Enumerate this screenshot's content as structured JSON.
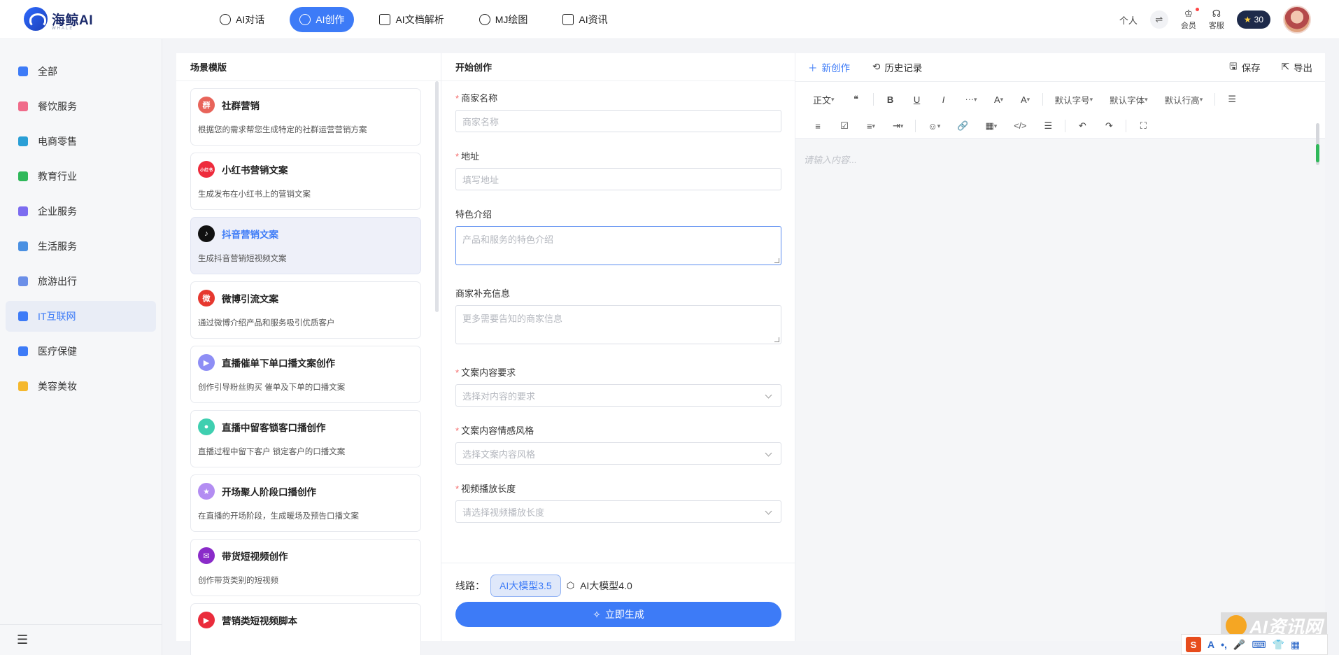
{
  "header": {
    "logo_text": "海鲸AI",
    "logo_sub": "WHALE",
    "nav": [
      {
        "label": "AI对话",
        "icon": "chat-icon",
        "active": false
      },
      {
        "label": "AI创作",
        "icon": "create-icon",
        "active": true
      },
      {
        "label": "AI文档解析",
        "icon": "pdf-icon",
        "active": false
      },
      {
        "label": "MJ绘图",
        "icon": "palette-icon",
        "active": false
      },
      {
        "label": "AI资讯",
        "icon": "news-icon",
        "active": false
      }
    ],
    "personal": "个人",
    "swap_icon": "⇌",
    "member": "会员",
    "service": "客服",
    "points": "30"
  },
  "sidebar": {
    "items": [
      {
        "label": "全部",
        "color": "#3d7bf7"
      },
      {
        "label": "餐饮服务",
        "color": "#f06b8a"
      },
      {
        "label": "电商零售",
        "color": "#2a9fd6"
      },
      {
        "label": "教育行业",
        "color": "#2fb85a"
      },
      {
        "label": "企业服务",
        "color": "#7c6cf0"
      },
      {
        "label": "生活服务",
        "color": "#4a90e2"
      },
      {
        "label": "旅游出行",
        "color": "#6b8fe8"
      },
      {
        "label": "IT互联网",
        "color": "#3d7bf7"
      },
      {
        "label": "医疗保健",
        "color": "#3d7bf7"
      },
      {
        "label": "美容美妆",
        "color": "#f5b82e"
      }
    ],
    "active_index": 7,
    "menu_icon": "☰"
  },
  "templates": {
    "title": "场景模版",
    "items": [
      {
        "name": "社群营销",
        "desc": "根据您的需求帮您生成特定的社群运营营销方案",
        "color": "#e8645a",
        "glyph": "群"
      },
      {
        "name": "小红书营销文案",
        "desc": "生成发布在小红书上的营销文案",
        "color": "#ee2b3c",
        "glyph": "小红书"
      },
      {
        "name": "抖音营销文案",
        "desc": "生成抖音营销短视频文案",
        "color": "#111111",
        "glyph": "♪"
      },
      {
        "name": "微博引流文案",
        "desc": "通过微博介绍产品和服务吸引优质客户",
        "color": "#e6382f",
        "glyph": "微"
      },
      {
        "name": "直播催单下单口播文案创作",
        "desc": "创作引导粉丝购买 催单及下单的口播文案",
        "color": "#8e8ef5",
        "glyph": "▶"
      },
      {
        "name": "直播中留客锁客口播创作",
        "desc": "直播过程中留下客户 锁定客户的口播文案",
        "color": "#3fcfb0",
        "glyph": "●"
      },
      {
        "name": "开场聚人阶段口播创作",
        "desc": "在直播的开场阶段，生成暖场及预告口播文案",
        "color": "#b38df2",
        "glyph": "★"
      },
      {
        "name": "带货短视频创作",
        "desc": "创作带货类别的短视频",
        "color": "#8a2bc9",
        "glyph": "✉"
      },
      {
        "name": "营销类短视频脚本",
        "desc": "",
        "color": "#ea2c3c",
        "glyph": "▶"
      }
    ],
    "active_index": 2
  },
  "form": {
    "title": "开始创作",
    "fields": [
      {
        "label": "商家名称",
        "required": true,
        "placeholder": "商家名称",
        "kind": "input"
      },
      {
        "label": "地址",
        "required": true,
        "placeholder": "填写地址",
        "kind": "input"
      },
      {
        "label": "特色介绍",
        "required": false,
        "placeholder": "产品和服务的特色介绍",
        "kind": "textarea",
        "focus": true
      },
      {
        "label": "商家补充信息",
        "required": false,
        "placeholder": "更多需要告知的商家信息",
        "kind": "textarea"
      },
      {
        "label": "文案内容要求",
        "required": true,
        "placeholder": "选择对内容的要求",
        "kind": "select"
      },
      {
        "label": "文案内容情感风格",
        "required": true,
        "placeholder": "选择文案内容风格",
        "kind": "select"
      },
      {
        "label": "视频播放长度",
        "required": true,
        "placeholder": "请选择视频播放长度",
        "kind": "select"
      }
    ],
    "route_label": "线路：",
    "model_a": "AI大模型3.5",
    "model_b": "AI大模型4.0",
    "generate": "立即生成"
  },
  "editor": {
    "new": "新创作",
    "history": "历史记录",
    "save": "保存",
    "export": "导出",
    "toolbar_row1": [
      "正文",
      "❝",
      "B",
      "U",
      "I",
      "···",
      "A",
      "A",
      "默认字号",
      "默认字体",
      "默认行高",
      "☰"
    ],
    "toolbar_row2": [
      "≡",
      "☑",
      "≡",
      "⇥",
      "☺",
      "🔗",
      "▦",
      "</>",
      "☰",
      "↶",
      "↷",
      "⛶"
    ],
    "placeholder": "请输入内容..."
  },
  "watermark": {
    "text": "AI资讯网",
    "ime": "A"
  }
}
